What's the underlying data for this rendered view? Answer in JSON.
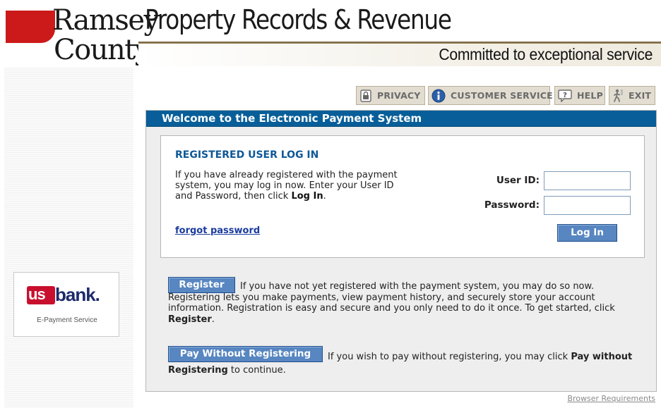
{
  "header": {
    "logo_line1": "Ramsey",
    "logo_line2": "County",
    "title": "Property Records & Revenue",
    "tagline": "Committed to exceptional service"
  },
  "nav": {
    "privacy": "PRIVACY",
    "customer_service": "CUSTOMER SERVICE",
    "help": "HELP",
    "exit": "EXIT"
  },
  "panel": {
    "title": "Welcome to the Electronic Payment System"
  },
  "login": {
    "heading": "REGISTERED USER LOG IN",
    "text_before": "If you have already registered with the payment system, you may log in now. Enter your User ID and Password, then click ",
    "text_bold": "Log In",
    "text_after": ".",
    "user_id_label": "User ID:",
    "password_label": "Password:",
    "user_id_value": "",
    "password_value": "",
    "login_button": "Log In",
    "forgot_link": "forgot password"
  },
  "register": {
    "button": "Register",
    "text_before": "If you have not yet registered with the payment system, you may do so now. Registering lets you make payments, view payment history, and securely store your account information. Registration is easy and secure and you only need to do it once. To get started, click ",
    "text_bold": "Register",
    "text_after": "."
  },
  "pay_without": {
    "button": "Pay Without Registering",
    "text_before": "If you wish to pay without registering, you may click ",
    "text_bold": "Pay without Registering",
    "text_after": " to continue."
  },
  "bank": {
    "logo_us": "us",
    "logo_bank": "bank.",
    "caption": "E-Payment Service"
  },
  "footer": {
    "browser_requirements": "Browser Requirements"
  },
  "colors": {
    "panel_header": "#075e99",
    "heading_blue": "#0e5897",
    "button_blue": "#5786c1",
    "county_red": "#cc1a1a"
  },
  "icons": [
    "privacy-icon",
    "info-icon",
    "help-icon",
    "exit-icon"
  ]
}
